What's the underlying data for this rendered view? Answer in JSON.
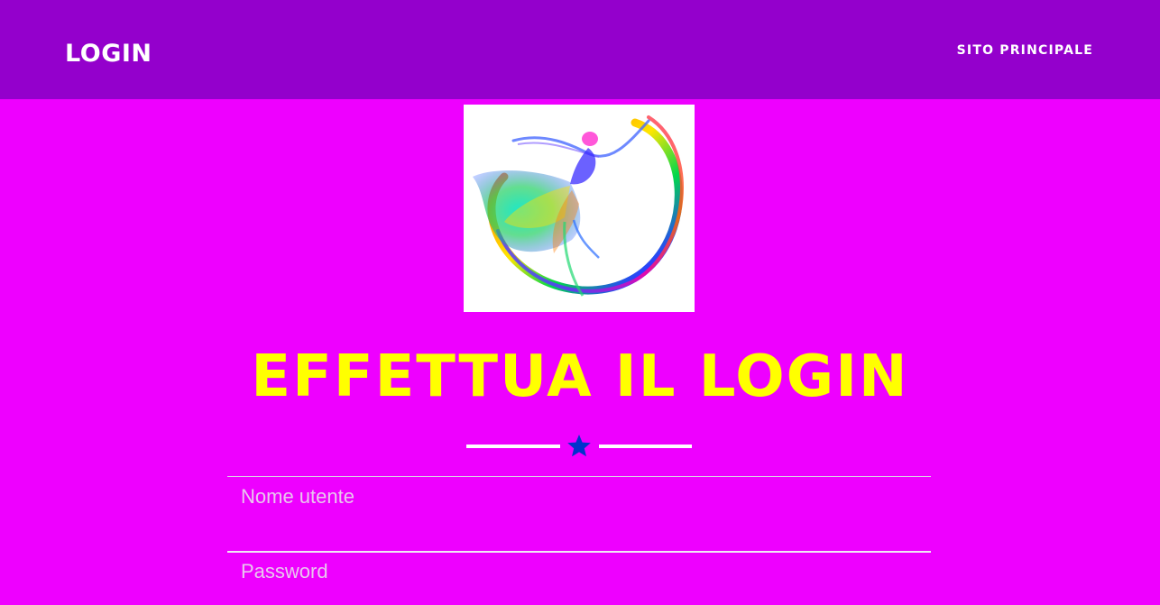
{
  "navbar": {
    "brand": "LOGIN",
    "main_site_link": "SITO PRINCIPALE",
    "background": "#9400cc"
  },
  "logo": {
    "icon": "rainbow-dancer-logo",
    "background": "#ffffff"
  },
  "main": {
    "title": "EFFETTUA IL LOGIN",
    "title_color": "#ffff00",
    "divider_icon": "star-icon",
    "divider_icon_color": "#0033cc"
  },
  "form": {
    "username": {
      "label": "Nome utente",
      "value": ""
    },
    "password": {
      "label": "Password",
      "value": ""
    }
  },
  "colors": {
    "page_background": "#ee00ff",
    "label_text": "#e9c7ee"
  }
}
